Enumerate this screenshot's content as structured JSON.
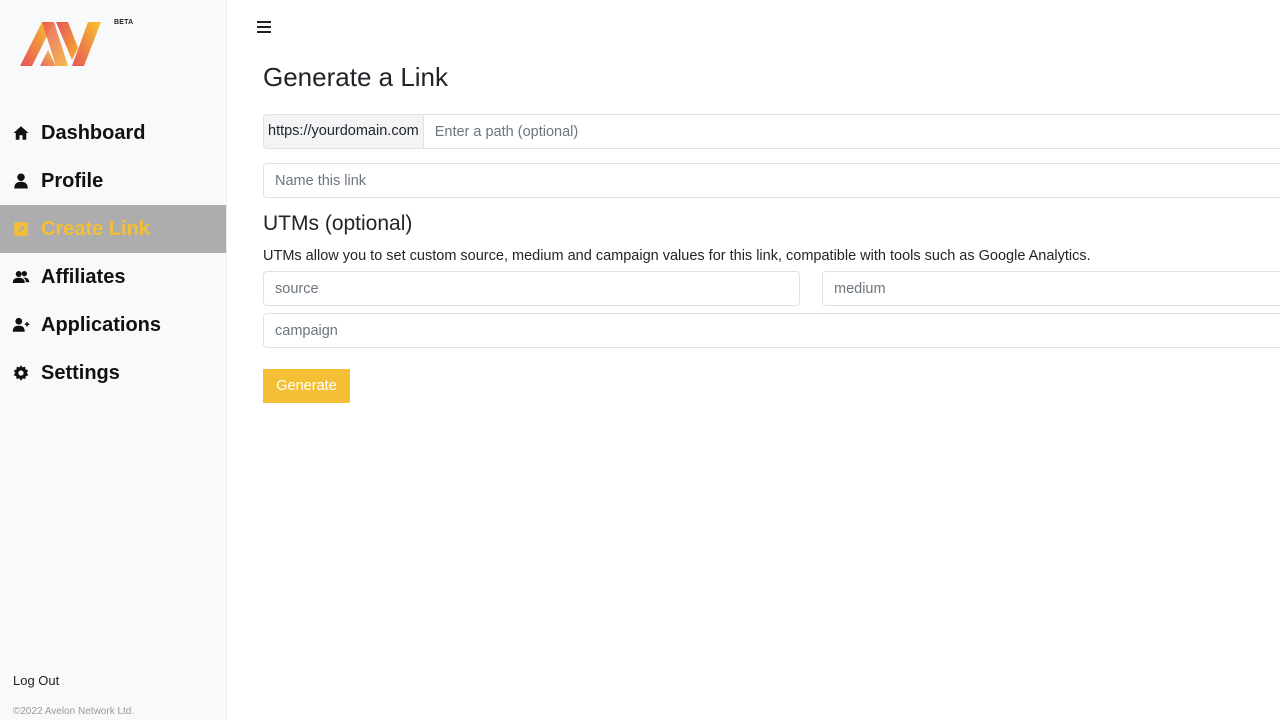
{
  "brand": {
    "logo_text": "AV",
    "badge": "BETA",
    "gradient_start": "#e8525a",
    "gradient_end": "#f7c62b"
  },
  "sidebar": {
    "items": [
      {
        "label": "Dashboard",
        "icon": "home-icon",
        "active": false
      },
      {
        "label": "Profile",
        "icon": "user-icon",
        "active": false
      },
      {
        "label": "Create Link",
        "icon": "external-link-square-icon",
        "active": true
      },
      {
        "label": "Affiliates",
        "icon": "users-icon",
        "active": false
      },
      {
        "label": "Applications",
        "icon": "user-plus-icon",
        "active": false
      },
      {
        "label": "Settings",
        "icon": "gear-icon",
        "active": false
      }
    ],
    "logout_label": "Log Out",
    "copyright": "©2022 Avelon Network Ltd.",
    "active_color": "#f4bf35",
    "active_bg": "#adadad"
  },
  "main": {
    "menu_icon": "hamburger-icon",
    "title": "Generate a Link",
    "url_prefix": "https://yourdomain.com",
    "path_input": {
      "value": "",
      "placeholder": "Enter a path (optional)"
    },
    "name_input": {
      "value": "",
      "placeholder": "Name this link"
    },
    "utm": {
      "title": "UTMs (optional)",
      "description": "UTMs allow you to set custom source, medium and campaign values for this link, compatible with tools such as Google Analytics.",
      "source": {
        "value": "",
        "placeholder": "source"
      },
      "medium": {
        "value": "",
        "placeholder": "medium"
      },
      "campaign": {
        "value": "",
        "placeholder": "campaign"
      }
    },
    "generate_label": "Generate",
    "accent_color": "#f4bf35"
  }
}
